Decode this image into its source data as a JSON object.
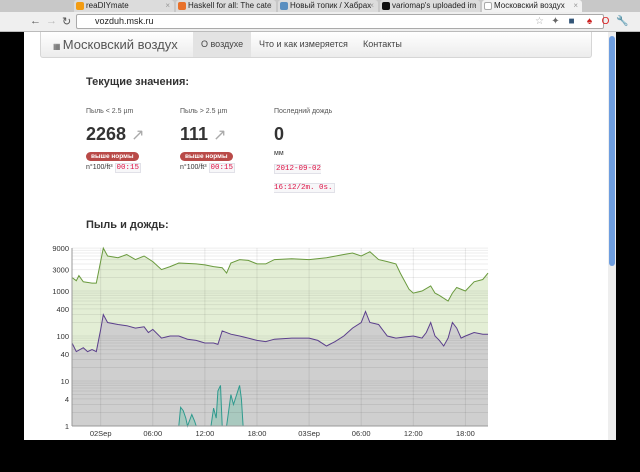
{
  "browser": {
    "tabs": [
      {
        "title": "reaDIYmate"
      },
      {
        "title": "Haskell for all: The cate"
      },
      {
        "title": "Новый топик / Хабрах"
      },
      {
        "title": "variomap's uploaded im"
      },
      {
        "title": "Московский воздух"
      }
    ],
    "url": "vozduh.msk.ru"
  },
  "navbar": {
    "brand": "Московский воздух",
    "items": [
      {
        "label": "О воздухе"
      },
      {
        "label": "Что и как измеряется"
      },
      {
        "label": "Контакты"
      }
    ]
  },
  "current": {
    "title": "Текущие значения:",
    "metrics": [
      {
        "label": "Пыль < 2.5 µm",
        "value": "2268",
        "badge": "выше нормы",
        "unit": "n°100/ft³",
        "time": "00:15"
      },
      {
        "label": "Пыль > 2.5 µm",
        "value": "111",
        "badge": "выше нормы",
        "unit": "n°100/ft³",
        "time": "00:15"
      },
      {
        "label": "Последний дождь",
        "value": "0",
        "unit": "мм",
        "time": "2012-09-02 16:12/2m. 0s."
      }
    ]
  },
  "chart_section": {
    "title": "Пыль и дождь:"
  },
  "chart_data": {
    "type": "area",
    "yscale": "log",
    "ylim": [
      1,
      10000
    ],
    "xlim": [
      -3.3,
      44.6
    ],
    "yticks": [
      9000,
      3000,
      1000,
      400,
      100,
      40,
      10,
      4,
      1
    ],
    "xticks": [
      {
        "x": 0,
        "label": "02Sep"
      },
      {
        "x": 6,
        "label": "06:00"
      },
      {
        "x": 12,
        "label": "12:00"
      },
      {
        "x": 18,
        "label": "18:00"
      },
      {
        "x": 24,
        "label": "03Sep"
      },
      {
        "x": 30,
        "label": "06:00"
      },
      {
        "x": 36,
        "label": "12:00"
      },
      {
        "x": 42,
        "label": "18:00"
      }
    ],
    "series": [
      {
        "name": "Пыль < 2.5 µm",
        "color": "#6a9a3e",
        "fill": "#e3eed5",
        "x": [
          -3.3,
          -2.8,
          -2.5,
          -2,
          -1,
          -0.5,
          0.3,
          0.8,
          2,
          3,
          4,
          5,
          6,
          7,
          8,
          9,
          11,
          12,
          13,
          14,
          14.5,
          15,
          16,
          17,
          18,
          19,
          20,
          22,
          24,
          26,
          28,
          29,
          30,
          31,
          32,
          33,
          34,
          34.5,
          35.5,
          36,
          37,
          38,
          38.5,
          39,
          40,
          40.5,
          41,
          42,
          43,
          44,
          44.6
        ],
        "y": [
          2000,
          1700,
          2200,
          1600,
          1500,
          1500,
          9000,
          6000,
          5500,
          6500,
          5000,
          6000,
          4500,
          3000,
          3500,
          4200,
          4000,
          3800,
          3500,
          3300,
          2500,
          4200,
          5000,
          4800,
          4000,
          4000,
          5000,
          5200,
          5000,
          5500,
          6500,
          7000,
          6000,
          7500,
          5000,
          4500,
          4000,
          2500,
          1100,
          900,
          1000,
          1300,
          900,
          800,
          600,
          900,
          1200,
          1000,
          1600,
          1800,
          2500
        ]
      },
      {
        "name": "Пыль > 2.5 µm",
        "color": "#5b3f8c",
        "fill": "#cfcfcf",
        "x": [
          -3.3,
          -2.8,
          -2,
          -1.5,
          -1,
          -0.5,
          0,
          0.3,
          0.8,
          2,
          3,
          4,
          5,
          5.5,
          6,
          7,
          8,
          9,
          10,
          11,
          12,
          13,
          13.5,
          14,
          15,
          16,
          17,
          18,
          19,
          20,
          22,
          24,
          25,
          26,
          27,
          28,
          29,
          30,
          30.5,
          31,
          32,
          33,
          34,
          35,
          36,
          37,
          37.5,
          38,
          38.5,
          39,
          39.5,
          40,
          40.5,
          41,
          41.5,
          42,
          43,
          44,
          44.6
        ],
        "y": [
          70,
          45,
          55,
          45,
          50,
          45,
          140,
          300,
          200,
          180,
          170,
          150,
          160,
          120,
          140,
          90,
          100,
          100,
          85,
          80,
          70,
          70,
          65,
          130,
          110,
          100,
          90,
          80,
          75,
          85,
          90,
          90,
          80,
          60,
          75,
          100,
          150,
          200,
          350,
          200,
          180,
          100,
          90,
          95,
          100,
          90,
          120,
          200,
          100,
          80,
          60,
          90,
          200,
          150,
          90,
          100,
          120,
          110,
          110
        ]
      },
      {
        "name": "Дождь",
        "color": "#2f9a8e",
        "fill": "#a9c9bf",
        "x": [
          9,
          9.2,
          9.5,
          9.8,
          10,
          10.5,
          10.8,
          11,
          12.7,
          13,
          13.3,
          13.5,
          13.8,
          14,
          14.5,
          15,
          15.3,
          16,
          16.2,
          16.4
        ],
        "y": [
          1,
          2.6,
          2.2,
          1.5,
          1,
          1.8,
          1.3,
          1,
          1,
          2.5,
          1.5,
          6,
          8,
          1,
          1,
          5,
          3,
          8,
          4,
          1
        ]
      }
    ]
  }
}
